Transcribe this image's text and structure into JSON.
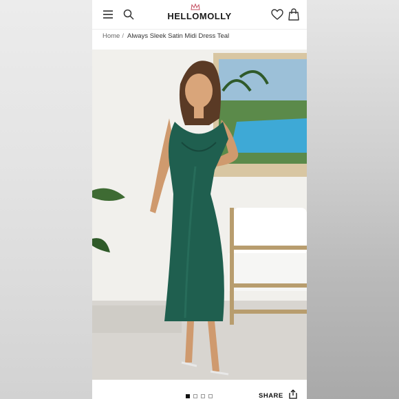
{
  "header": {
    "logo_text": "HELLOMOLLY",
    "menu_icon": "hamburger-icon",
    "search_icon": "search-icon",
    "wishlist_icon": "heart-icon",
    "cart_icon": "shopping-bag-icon"
  },
  "breadcrumb": {
    "home_label": "Home",
    "separator": "/",
    "current_label": "Always Sleek Satin Midi Dress Teal"
  },
  "gallery": {
    "image_count": 4,
    "active_index": 0
  },
  "actions": {
    "share_label": "SHARE",
    "share_icon": "share-icon"
  },
  "colors": {
    "dress": "#1f5f4f",
    "background_wall": "#f1f0ec"
  }
}
